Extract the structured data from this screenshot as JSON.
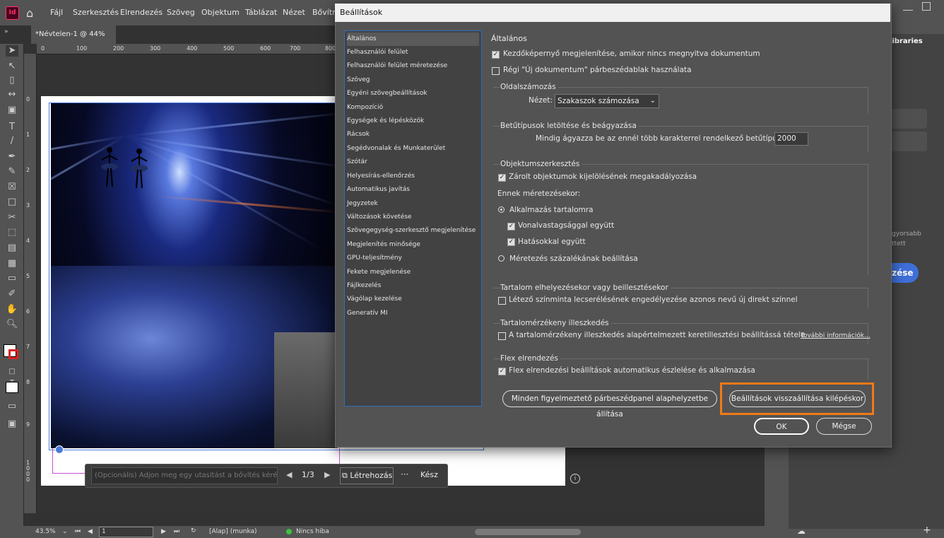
{
  "menubar": {
    "app_logo": "Id",
    "items": [
      "Fájl",
      "Szerkesztés",
      "Elrendezés",
      "Szöveg",
      "Objektum",
      "Táblázat",
      "Nézet",
      "Bővítm"
    ]
  },
  "document_tab": "*Névtelen-1 @ 44%",
  "ruler": {
    "h": [
      "0",
      "100",
      "200",
      "300",
      "400",
      "500",
      "600",
      "700",
      "800"
    ],
    "v": [
      "0",
      "1",
      "2",
      "3",
      "4",
      "5",
      "6",
      "7",
      "8",
      "9",
      "1000"
    ]
  },
  "prompt_bar": {
    "placeholder": "(Opcionális) Adjon meg egy utasítást a bővítés kérésére",
    "page": "1/3",
    "create_label": "Létrehozás",
    "more": "···",
    "done_label": "Kész"
  },
  "status_bar": {
    "zoom": "43.5%",
    "page": "1",
    "master": "[Alap] (munka)",
    "preflight": "Nincs hiba"
  },
  "right_panel": {
    "tab": "Libraries",
    "text1": "gyorsabb",
    "text2": "ttett",
    "button": "ezése"
  },
  "dialog": {
    "title": "Beállítások",
    "categories": [
      "Általános",
      "Felhasználói felület",
      "Felhasználói felület méretezése",
      "Szöveg",
      "Egyéni szövegbeállítások",
      "Kompozíció",
      "Egységek és lépésközök",
      "Rácsok",
      "Segédvonalak és Munkaterület",
      "Szótár",
      "Helyesírás-ellenőrzés",
      "Automatikus javítás",
      "Jegyzetek",
      "Változások követése",
      "Szövegegység-szerkesztő megjelenítése",
      "Megjelenítés minősége",
      "GPU-teljesítmény",
      "Fekete megjelenése",
      "Fájlkezelés",
      "Vágólap kezelése",
      "Generatív MI"
    ],
    "selected_category": "Általános",
    "section_title": "Általános",
    "cb_welcome": "Kezdőképernyő megjelenítése, amikor nincs megnyitva dokumentum",
    "cb_legacy_new": "Régi \"Új dokumentum\" párbeszédablak használata",
    "page_numbering_title": "Oldalszámozás",
    "view_label": "Nézet:",
    "view_value": "Szakaszok számozása",
    "font_title": "Betűtípusok letöltése és beágyazása",
    "font_label": "Mindig ágyazza be az ennél több karakterrel rendelkező betűtípusokat:",
    "font_value": "2000",
    "obj_title": "Objektumszerkesztés",
    "cb_locked": "Zárolt objektumok kijelölésének megakadályozása",
    "scaling_label": "Ennek méretezésekor:",
    "radio_apply": "Alkalmazás tartalomra",
    "cb_stroke": "Vonalvastagsággal együtt",
    "cb_effects": "Hatásokkal együtt",
    "radio_percent": "Méretezés százalékának beállítása",
    "paste_title": "Tartalom elhelyezésekor vagy beillesztésekor",
    "cb_swatch": "Létező színminta lecserélésének engedélyezése azonos nevű új direkt színnel",
    "fit_title": "Tartalomérzékeny illeszkedés",
    "cb_fit": "A tartalomérzékeny illeszkedés alapértelmezett keretillesztési beállítássá tétele",
    "more_info": "További információk...",
    "flex_title": "Flex elrendezés",
    "cb_flex": "Flex elrendezési beállítások automatikus észlelése és alkalmazása",
    "reset_warnings": "Minden figyelmeztető párbeszédpanel alaphelyzetbe állítása",
    "reset_prefs": "Beállítások visszaállítása kilépéskor",
    "ok": "OK",
    "cancel": "Mégse"
  },
  "colors": {
    "accent_orange": "#f07a16",
    "selection_blue": "#2f6fbf",
    "dialog_bg": "#535353"
  }
}
